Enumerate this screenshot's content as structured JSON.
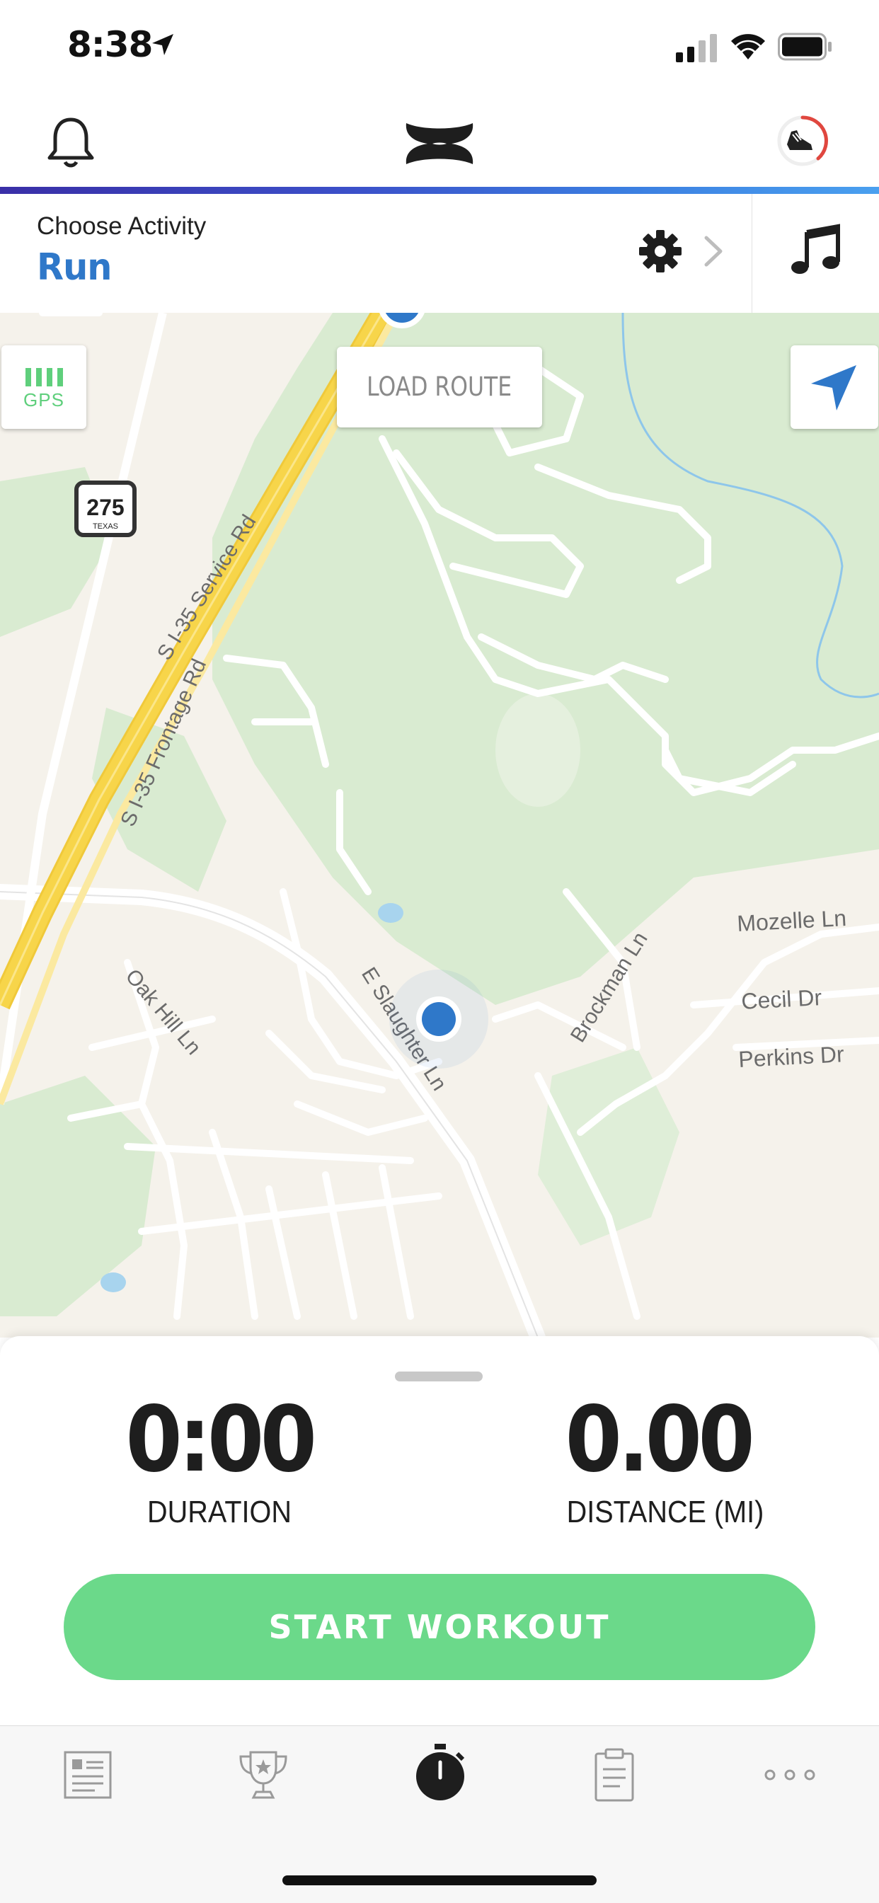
{
  "status_bar": {
    "time": "8:38",
    "icons": [
      "location-arrow-icon",
      "cellular-signal-icon",
      "wifi-icon",
      "battery-icon"
    ]
  },
  "header": {
    "left_icon": "bell-icon",
    "center_logo": "under-armour-logo",
    "right_icon": "shoe-icon"
  },
  "activity": {
    "label": "Choose Activity",
    "value": "Run",
    "settings_icon": "gear-icon",
    "music_icon": "music-note-icon"
  },
  "map": {
    "gps_label": "GPS",
    "load_route_label": "LOAD ROUTE",
    "route_shield": {
      "number": "275",
      "state": "TEXAS"
    },
    "street_labels": {
      "service_rd": "S I-35 Service Rd",
      "frontage_rd": "S I-35 Frontage Rd",
      "oak_hill": "Oak Hill Ln",
      "slaughter": "E Slaughter Ln",
      "brockman": "Brockman Ln",
      "mozelle": "Mozelle Ln",
      "cecil": "Cecil Dr",
      "perkins": "Perkins Dr"
    }
  },
  "stats": {
    "duration_value": "0:00",
    "duration_label": "DURATION",
    "distance_value": "0.00",
    "distance_label": "DISTANCE (MI)"
  },
  "start_button": "START WORKOUT",
  "tabbar": {
    "items": [
      {
        "icon": "feed-icon"
      },
      {
        "icon": "trophy-icon"
      },
      {
        "icon": "stopwatch-icon",
        "active": true
      },
      {
        "icon": "clipboard-icon"
      },
      {
        "icon": "more-icon"
      }
    ]
  },
  "colors": {
    "accent_blue": "#2f78c9",
    "start_green": "#6bd98a",
    "gps_green": "#5fcf7c",
    "highway_yellow": "#f7d54a",
    "park_green": "#d9ebd1"
  }
}
